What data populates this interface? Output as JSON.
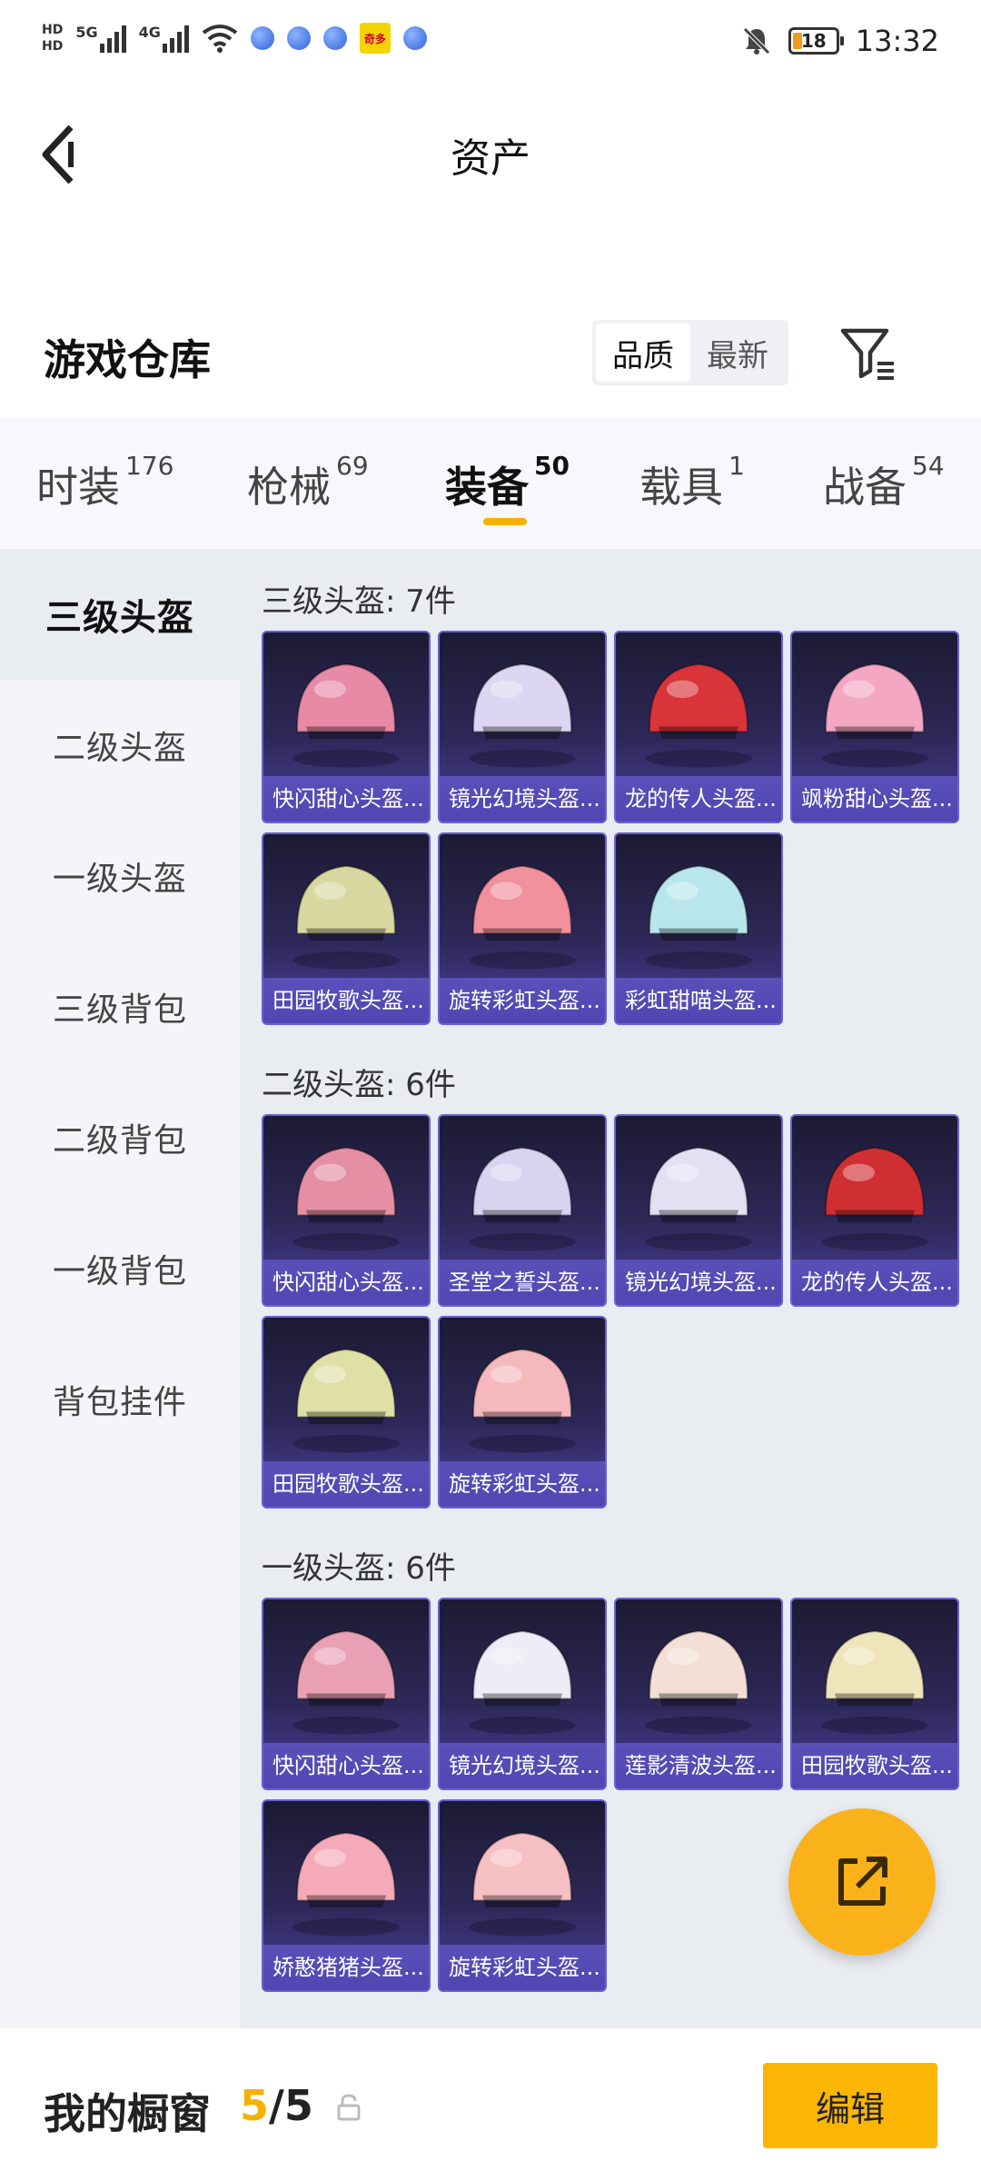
{
  "status_bar": {
    "hd1": "HD",
    "hd2": "HD",
    "net1": "5G",
    "net2": "4G",
    "app_badge": "奇多",
    "battery": "18",
    "time": "13:32"
  },
  "header": {
    "title": "资产"
  },
  "warehouse": {
    "title": "游戏仓库",
    "sort_options": [
      "品质",
      "最新"
    ],
    "active_sort": "品质"
  },
  "tabs": [
    {
      "label": "时装",
      "count": "176"
    },
    {
      "label": "枪械",
      "count": "69"
    },
    {
      "label": "装备",
      "count": "50",
      "active": true
    },
    {
      "label": "载具",
      "count": "1"
    },
    {
      "label": "战备",
      "count": "54"
    }
  ],
  "sidebar": {
    "items": [
      "三级头盔",
      "二级头盔",
      "一级头盔",
      "三级背包",
      "二级背包",
      "一级背包",
      "背包挂件"
    ],
    "active": "三级头盔"
  },
  "sections": [
    {
      "title": "三级头盔: 7件",
      "items": [
        {
          "name": "快闪甜心头盔...",
          "color": "#e889a6"
        },
        {
          "name": "镜光幻境头盔...",
          "color": "#dcd6f2"
        },
        {
          "name": "龙的传人头盔...",
          "color": "#d8343a"
        },
        {
          "name": "飒粉甜心头盔...",
          "color": "#f3a7c3"
        },
        {
          "name": "田园牧歌头盔...",
          "color": "#d8d7a0"
        },
        {
          "name": "旋转彩虹头盔...",
          "color": "#f2909d"
        },
        {
          "name": "彩虹甜喵头盔...",
          "color": "#b8e6ec"
        }
      ]
    },
    {
      "title": "二级头盔: 6件",
      "items": [
        {
          "name": "快闪甜心头盔...",
          "color": "#e58fa5"
        },
        {
          "name": "圣堂之誓头盔...",
          "color": "#d9d2f0"
        },
        {
          "name": "镜光幻境头盔...",
          "color": "#e4e0f3"
        },
        {
          "name": "龙的传人头盔...",
          "color": "#cf2f33"
        },
        {
          "name": "田园牧歌头盔...",
          "color": "#dfe0a6"
        },
        {
          "name": "旋转彩虹头盔...",
          "color": "#f5b8bd"
        }
      ]
    },
    {
      "title": "一级头盔: 6件",
      "items": [
        {
          "name": "快闪甜心头盔...",
          "color": "#e9a0b4"
        },
        {
          "name": "镜光幻境头盔...",
          "color": "#eeecf6"
        },
        {
          "name": "莲影清波头盔...",
          "color": "#f3dfd5"
        },
        {
          "name": "田园牧歌头盔...",
          "color": "#eee5bb"
        },
        {
          "name": "娇憨猪猪头盔...",
          "color": "#f4aab9"
        },
        {
          "name": "旋转彩虹头盔...",
          "color": "#f6bfc4"
        }
      ]
    }
  ],
  "bottom_bar": {
    "label": "我的橱窗",
    "count_current": "5",
    "count_total": "/5",
    "edit_label": "编辑"
  }
}
